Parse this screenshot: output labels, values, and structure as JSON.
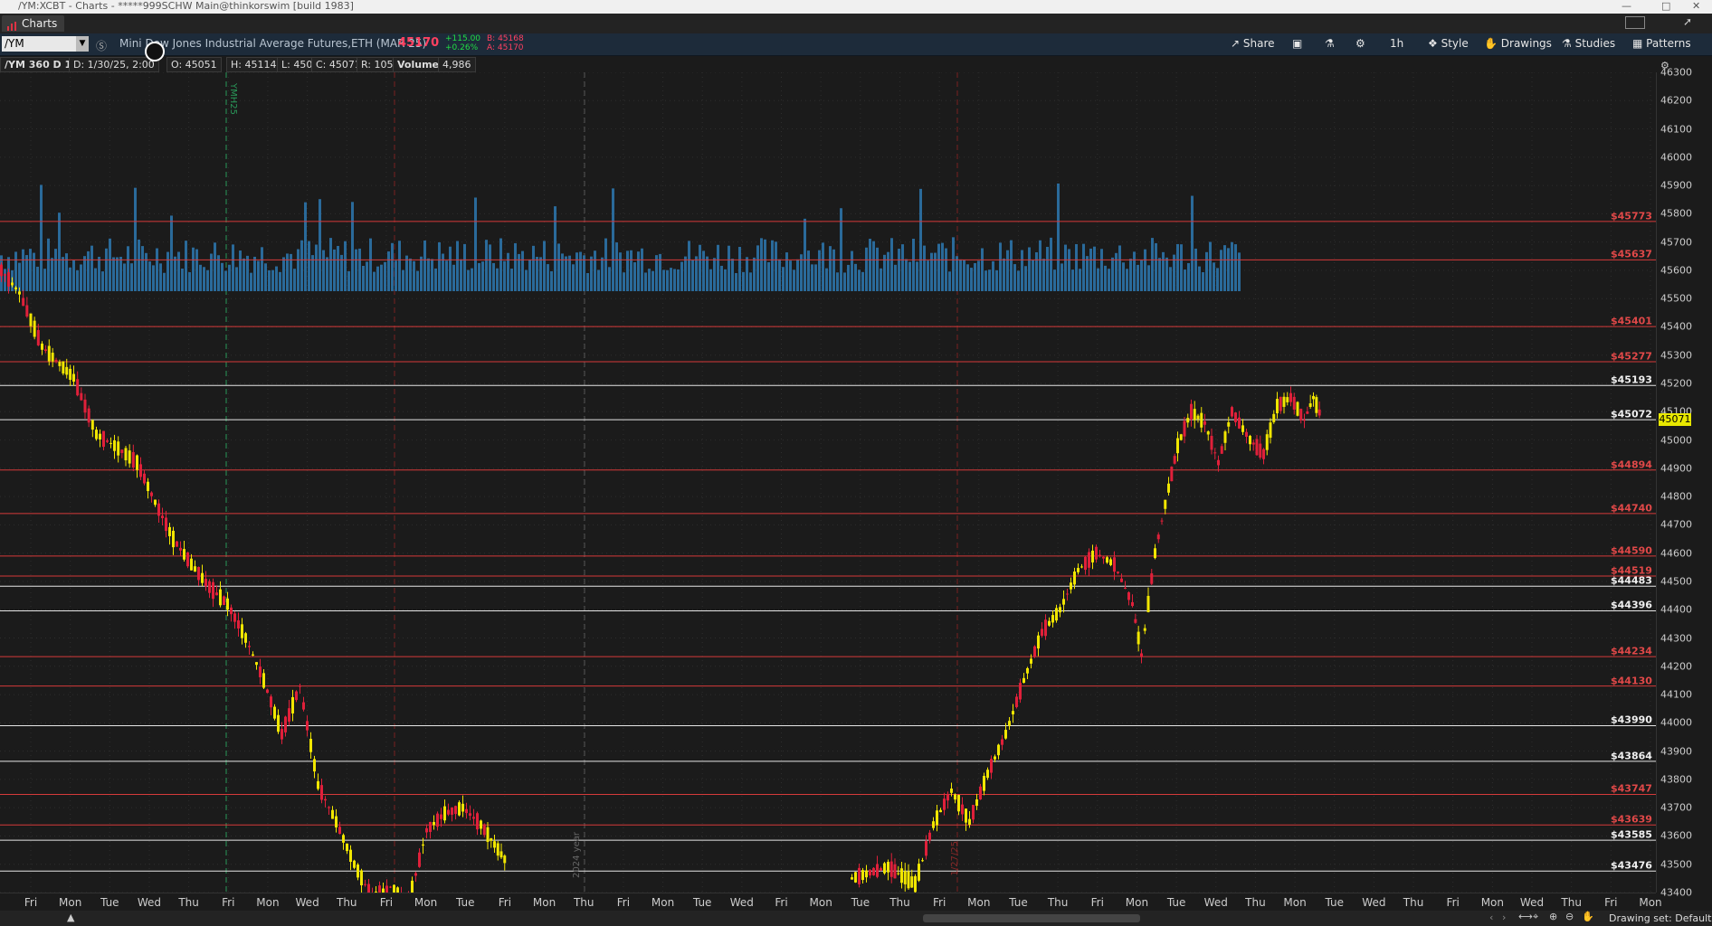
{
  "window": {
    "title": "/YM:XCBT - Charts - *****999SCHW Main@thinkorswim [build 1983]"
  },
  "tab": {
    "label": "Charts"
  },
  "toolbar": {
    "symbol": "/YM",
    "description": "Mini Dow Jones Industrial Average Futures,ETH (MAR 25)",
    "price": "45170",
    "change": "+115.00",
    "change_pct": "+0.26%",
    "bid": "B: 45168",
    "ask": "A: 45170",
    "share": "Share",
    "timeframe": "1h",
    "style": "Style",
    "drawings": "Drawings",
    "studies": "Studies",
    "patterns": "Patterns"
  },
  "infobar": {
    "chart_label": "/YM 360 D 1h",
    "date": "D: 1/30/25, 2:00",
    "open": "O: 45051",
    "high": "H: 45114",
    "low": "L: 45009",
    "close": "C: 45071",
    "range": "R: 105",
    "volume_label": "Volume",
    "volume_value": "4,986"
  },
  "annotations": {
    "contract": "YMH25",
    "year": "2024 year",
    "date_marker": "1/27/25"
  },
  "bottom": {
    "drawing_set": "Drawing set: Default"
  },
  "colors": {
    "bull": "#f1e600",
    "bear": "#e0203a",
    "volume": "#2a6a9a",
    "red_line": "#d53a3a",
    "white_line": "#e6e6e6",
    "last_price_bg": "#e8e800"
  },
  "chart_data": {
    "type": "candlestick",
    "ylim": [
      43400,
      46300
    ],
    "y_ticks": [
      43400,
      43500,
      43600,
      43700,
      43800,
      43900,
      44000,
      44100,
      44200,
      44300,
      44400,
      44500,
      44600,
      44700,
      44800,
      44900,
      45000,
      45100,
      45200,
      45300,
      45400,
      45500,
      45600,
      45700,
      45800,
      45900,
      46000,
      46100,
      46200,
      46300
    ],
    "x_ticks": [
      "Fri",
      "Mon",
      "Tue",
      "Wed",
      "Thu",
      "Fri",
      "Mon",
      "Wed",
      "Thu",
      "Fri",
      "Mon",
      "Tue",
      "Fri",
      "Mon",
      "Thu",
      "Fri",
      "Mon",
      "Tue",
      "Wed",
      "Fri",
      "Mon",
      "Tue",
      "Thu",
      "Fri",
      "Mon",
      "Tue",
      "Thu",
      "Fri",
      "Mon",
      "Tue",
      "Wed",
      "Thu",
      "Mon",
      "Tue",
      "Wed",
      "Thu",
      "Fri",
      "Mon",
      "Wed",
      "Thu",
      "Fri",
      "Mon"
    ],
    "levels": [
      {
        "value": 45773,
        "label": "$45773",
        "color": "red"
      },
      {
        "value": 45637,
        "label": "$45637",
        "color": "red"
      },
      {
        "value": 45401,
        "label": "$45401",
        "color": "red"
      },
      {
        "value": 45277,
        "label": "$45277",
        "color": "red"
      },
      {
        "value": 45193,
        "label": "$45193",
        "color": "white"
      },
      {
        "value": 45072,
        "label": "$45072",
        "color": "white"
      },
      {
        "value": 44894,
        "label": "$44894",
        "color": "red"
      },
      {
        "value": 44740,
        "label": "$44740",
        "color": "red"
      },
      {
        "value": 44590,
        "label": "$44590",
        "color": "red"
      },
      {
        "value": 44519,
        "label": "$44519",
        "color": "red"
      },
      {
        "value": 44483,
        "label": "$44483",
        "color": "white"
      },
      {
        "value": 44396,
        "label": "$44396",
        "color": "white"
      },
      {
        "value": 44234,
        "label": "$44234",
        "color": "red"
      },
      {
        "value": 44130,
        "label": "$44130",
        "color": "red"
      },
      {
        "value": 43990,
        "label": "$43990",
        "color": "white"
      },
      {
        "value": 43864,
        "label": "$43864",
        "color": "white"
      },
      {
        "value": 43747,
        "label": "$43747",
        "color": "red"
      },
      {
        "value": 43639,
        "label": "$43639",
        "color": "red"
      },
      {
        "value": 43585,
        "label": "$43585",
        "color": "white"
      },
      {
        "value": 43476,
        "label": "$43476",
        "color": "white"
      }
    ],
    "last_price": "45071",
    "price_path": [
      [
        0,
        45600
      ],
      [
        20,
        45520
      ],
      [
        45,
        45330
      ],
      [
        80,
        45220
      ],
      [
        105,
        45020
      ],
      [
        125,
        44980
      ],
      [
        150,
        44920
      ],
      [
        170,
        44780
      ],
      [
        190,
        44650
      ],
      [
        210,
        44560
      ],
      [
        230,
        44480
      ],
      [
        250,
        44420
      ],
      [
        270,
        44300
      ],
      [
        290,
        44150
      ],
      [
        310,
        43960
      ],
      [
        330,
        44130
      ],
      [
        350,
        43780
      ],
      [
        370,
        43650
      ],
      [
        390,
        43500
      ],
      [
        410,
        43380
      ],
      [
        430,
        43420
      ],
      [
        450,
        43360
      ],
      [
        470,
        43620
      ],
      [
        490,
        43680
      ],
      [
        510,
        43700
      ],
      [
        530,
        43640
      ],
      [
        560,
        43500
      ]
    ],
    "price_path2": [
      [
        940,
        43450
      ],
      [
        980,
        43490
      ],
      [
        1010,
        43430
      ],
      [
        1030,
        43640
      ],
      [
        1050,
        43760
      ],
      [
        1070,
        43650
      ],
      [
        1090,
        43820
      ],
      [
        1110,
        43960
      ],
      [
        1130,
        44150
      ],
      [
        1150,
        44320
      ],
      [
        1170,
        44400
      ],
      [
        1190,
        44540
      ],
      [
        1210,
        44600
      ],
      [
        1230,
        44560
      ],
      [
        1250,
        44420
      ],
      [
        1260,
        44240
      ],
      [
        1275,
        44600
      ],
      [
        1290,
        44830
      ],
      [
        1300,
        44980
      ],
      [
        1315,
        45100
      ],
      [
        1330,
        45060
      ],
      [
        1345,
        44920
      ],
      [
        1360,
        45100
      ],
      [
        1380,
        45000
      ],
      [
        1395,
        44950
      ],
      [
        1410,
        45120
      ],
      [
        1425,
        45150
      ],
      [
        1440,
        45070
      ],
      [
        1450,
        45150
      ],
      [
        1460,
        45071
      ]
    ]
  }
}
